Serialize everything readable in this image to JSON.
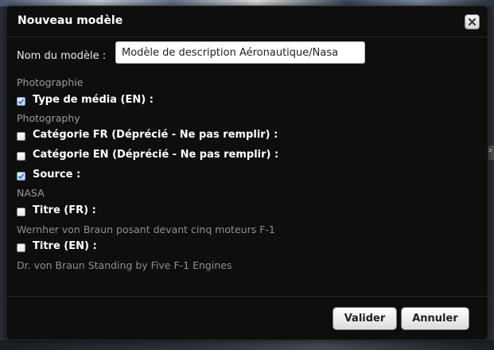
{
  "modal": {
    "title": "Nouveau modèle"
  },
  "form": {
    "name_label": "Nom du modèle :",
    "name_value": "Modèle de description Aéronautique/Nasa"
  },
  "fields": [
    {
      "caption": "Photographie"
    },
    {
      "label": "Type de média (EN) :",
      "checked": true
    },
    {
      "caption": "Photography"
    },
    {
      "label": "Catégorie FR (Déprécié - Ne pas remplir) :",
      "checked": false
    },
    {
      "label": "Catégorie EN (Déprécié - Ne pas remplir) :",
      "checked": false
    },
    {
      "label": "Source :",
      "checked": true
    },
    {
      "caption": "NASA"
    },
    {
      "label": "Titre (FR) :",
      "checked": false
    },
    {
      "caption": "Wernher von Braun posant devant cinq moteurs F-1"
    },
    {
      "label": "Titre (EN) :",
      "checked": false
    },
    {
      "caption": "Dr. von Braun Standing by Five F-1 Engines"
    }
  ],
  "footer": {
    "validate_label": "Valider",
    "cancel_label": "Annuler"
  },
  "background": {
    "right_tab_text": "P"
  },
  "colors": {
    "modal_bg": "#0e0e0e",
    "check_accent": "#3a6fd0",
    "caption_text": "#9c9c9c"
  },
  "icons": {
    "close": "close-icon",
    "check": "checkmark-icon"
  }
}
